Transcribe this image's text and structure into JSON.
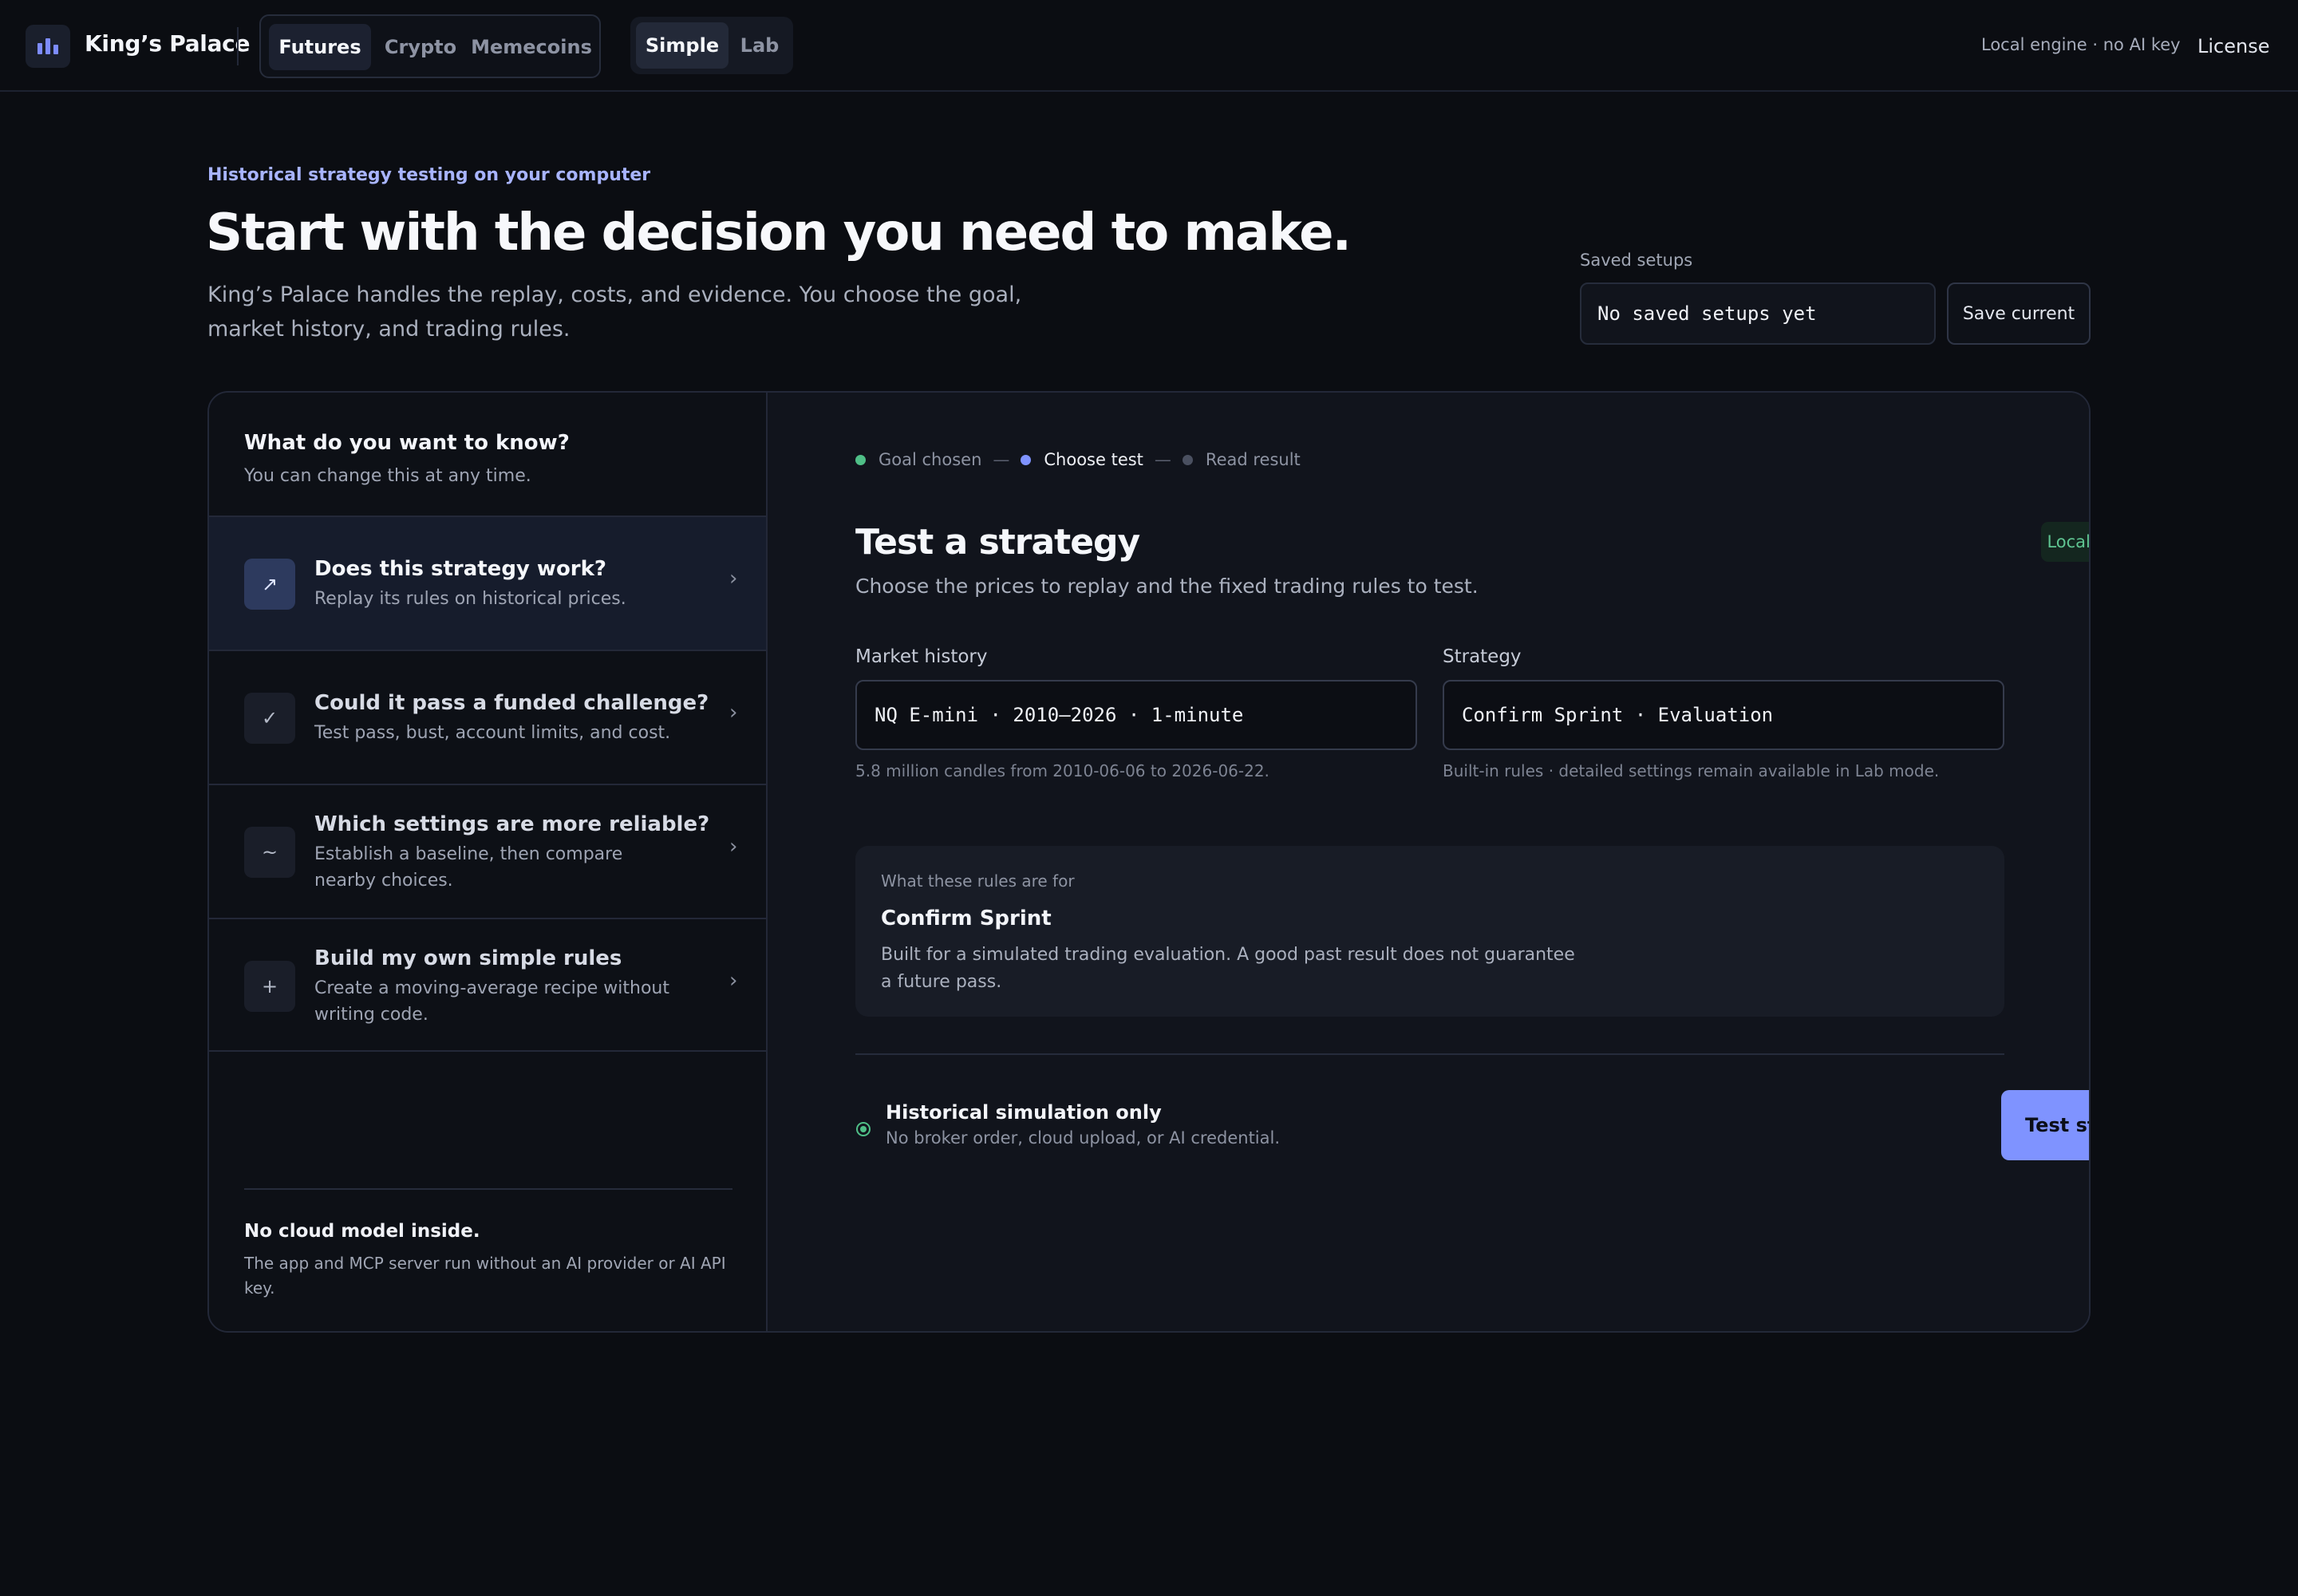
{
  "brand": {
    "name": "King’s Palace",
    "logo_icon": "bar-chart-icon"
  },
  "markets": {
    "tabs": [
      "Futures",
      "Crypto",
      "Memecoins"
    ],
    "active": "Futures"
  },
  "modes": {
    "tabs": [
      "Simple",
      "Lab"
    ],
    "active": "Simple"
  },
  "header": {
    "engine_status": "Local engine · no AI key",
    "license": "License"
  },
  "hero": {
    "eyebrow": "Historical strategy testing on your computer",
    "title": "Start with the decision you need to make.",
    "subtitle": "King’s Palace handles the replay, costs, and evidence. You choose the goal, market history, and trading rules."
  },
  "saved_setups": {
    "label": "Saved setups",
    "value": "No saved setups yet",
    "save_label": "Save current"
  },
  "goals": {
    "heading": "What do you want to know?",
    "hint": "You can change this at any time.",
    "items": [
      {
        "icon": "trend-arrow-icon",
        "glyph": "↗",
        "title": "Does this strategy work?",
        "desc": "Replay its rules on historical prices.",
        "active": true
      },
      {
        "icon": "check-icon",
        "glyph": "✓",
        "title": "Could it pass a funded challenge?",
        "desc": "Test pass, bust, account limits, and cost.",
        "active": false
      },
      {
        "icon": "tilde-icon",
        "glyph": "~",
        "title": "Which settings are more reliable?",
        "desc": "Establish a baseline, then compare nearby choices.",
        "active": false
      },
      {
        "icon": "plus-icon",
        "glyph": "+",
        "title": "Build my own simple rules",
        "desc": "Create a moving-average recipe without writing code.",
        "active": false
      }
    ],
    "footer_title": "No cloud model inside.",
    "footer_desc": "The app and MCP server run without an AI provider or AI API key."
  },
  "steps": [
    {
      "label": "Goal chosen",
      "state": "done",
      "color": "#4fbf87"
    },
    {
      "label": "Choose test",
      "state": "current",
      "color": "#7f93ff"
    },
    {
      "label": "Read result",
      "state": "todo",
      "color": "#4a5060"
    }
  ],
  "test": {
    "title": "Test a strategy",
    "subtitle": "Choose the prices to replay and the fixed trading rules to test.",
    "badge": "Local engine ready",
    "market_label": "Market history",
    "market_value": "NQ E-mini · 2010–2026 · 1-minute",
    "market_hint": "5.8 million candles from 2010-06-06 to 2026-06-22.",
    "strategy_label": "Strategy",
    "strategy_value": "Confirm Sprint · Evaluation",
    "strategy_hint": "Built-in rules · detailed settings remain available in Lab mode.",
    "rules_kicker": "What these rules are for",
    "rules_name": "Confirm Sprint",
    "rules_desc": "Built for a simulated trading evaluation. A good past result does not guarantee a future pass.",
    "safety_title": "Historical simulation only",
    "safety_desc": "No broker order, cloud upload, or AI credential.",
    "button_label": "Test strategy",
    "button_arrow": "→"
  },
  "colors": {
    "accent": "#7f93ff",
    "success": "#4fbf87",
    "background": "#0b0d12"
  }
}
